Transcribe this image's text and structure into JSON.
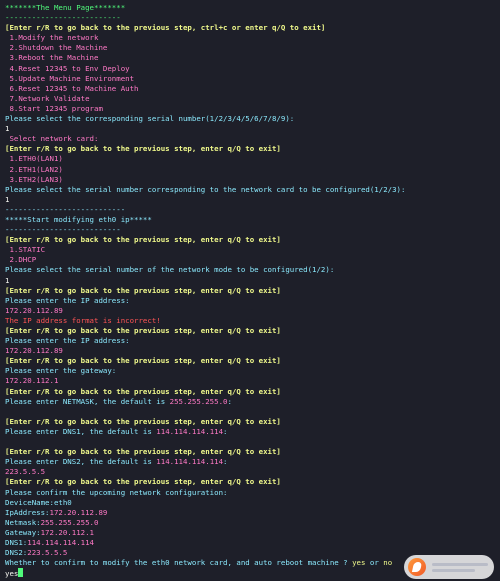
{
  "colors": {
    "green": "#50fa7b",
    "yellow": "#f1fa8c",
    "magenta": "#ff79c6",
    "cyan": "#8be9fd",
    "red": "#ff5555",
    "white": "#f8f8f2",
    "background": "#1e1f29"
  },
  "lines": [
    {
      "segments": [
        {
          "text": "*******The Menu Page*******",
          "color": "green"
        }
      ]
    },
    {
      "segments": [
        {
          "text": "--------------------------",
          "color": "green"
        }
      ]
    },
    {
      "segments": [
        {
          "text": "[Enter r/R to go back to the previous step, ctrl+c or enter q/Q to exit]",
          "color": "yellow",
          "bold": true
        }
      ]
    },
    {
      "segments": [
        {
          "text": " 1.Modify the network",
          "color": "magenta"
        }
      ]
    },
    {
      "segments": [
        {
          "text": " 2.Shutdown the Machine",
          "color": "magenta"
        }
      ]
    },
    {
      "segments": [
        {
          "text": " 3.Reboot the Machine",
          "color": "magenta"
        }
      ]
    },
    {
      "segments": [
        {
          "text": " 4.Reset 12345 to Env Deploy",
          "color": "magenta"
        }
      ]
    },
    {
      "segments": [
        {
          "text": " 5.Update Machine Environment",
          "color": "magenta"
        }
      ]
    },
    {
      "segments": [
        {
          "text": " 6.Reset 12345 to Machine Auth",
          "color": "magenta"
        }
      ]
    },
    {
      "segments": [
        {
          "text": " 7.Network Validate",
          "color": "magenta"
        }
      ]
    },
    {
      "segments": [
        {
          "text": " 8.Start 12345 program",
          "color": "magenta"
        }
      ]
    },
    {
      "segments": [
        {
          "text": "Please select the corresponding serial number(1/2/3/4/5/6/7/8/9):",
          "color": "cyan"
        }
      ]
    },
    {
      "segments": [
        {
          "text": "1",
          "color": "white"
        }
      ]
    },
    {
      "segments": [
        {
          "text": " Select network card:",
          "color": "magenta"
        }
      ]
    },
    {
      "segments": [
        {
          "text": "[Enter r/R to go back to the previous step, enter q/Q to exit]",
          "color": "yellow",
          "bold": true
        }
      ]
    },
    {
      "segments": [
        {
          "text": " 1.ETH0(LAN1)",
          "color": "magenta"
        }
      ]
    },
    {
      "segments": [
        {
          "text": " 2.ETH1(LAN2)",
          "color": "magenta"
        }
      ]
    },
    {
      "segments": [
        {
          "text": " 3.ETH2(LAN3)",
          "color": "magenta"
        }
      ]
    },
    {
      "segments": [
        {
          "text": "Please select the serial number corresponding to the network card to be configured(1/2/3):",
          "color": "cyan"
        }
      ]
    },
    {
      "segments": [
        {
          "text": "1",
          "color": "white"
        }
      ]
    },
    {
      "segments": [
        {
          "text": "---------------------------",
          "color": "cyan"
        }
      ]
    },
    {
      "segments": [
        {
          "text": "*****Start modifying eth0 ip*****",
          "color": "cyan"
        }
      ]
    },
    {
      "segments": [
        {
          "text": "--------------------------",
          "color": "cyan"
        }
      ]
    },
    {
      "segments": [
        {
          "text": "[Enter r/R to go back to the previous step, enter q/Q to exit]",
          "color": "yellow",
          "bold": true
        }
      ]
    },
    {
      "segments": [
        {
          "text": " 1.STATIC",
          "color": "magenta"
        }
      ]
    },
    {
      "segments": [
        {
          "text": " 2.DHCP",
          "color": "magenta"
        }
      ]
    },
    {
      "segments": [
        {
          "text": "Please select the serial number of the network mode to be configured(1/2):",
          "color": "cyan"
        }
      ]
    },
    {
      "segments": [
        {
          "text": "1",
          "color": "white"
        }
      ]
    },
    {
      "segments": [
        {
          "text": "[Enter r/R to go back to the previous step, enter q/Q to exit]",
          "color": "yellow",
          "bold": true
        }
      ]
    },
    {
      "segments": [
        {
          "text": "Please enter the IP address:",
          "color": "cyan"
        }
      ]
    },
    {
      "segments": [
        {
          "text": "172.20.112.89",
          "color": "magenta"
        }
      ]
    },
    {
      "segments": [
        {
          "text": "The IP address format is incorrect!",
          "color": "red"
        }
      ]
    },
    {
      "segments": [
        {
          "text": "[Enter r/R to go back to the previous step, enter q/Q to exit]",
          "color": "yellow",
          "bold": true
        }
      ]
    },
    {
      "segments": [
        {
          "text": "Please enter the IP address:",
          "color": "cyan"
        }
      ]
    },
    {
      "segments": [
        {
          "text": "172.20.112.89",
          "color": "magenta"
        }
      ]
    },
    {
      "segments": [
        {
          "text": "[Enter r/R to go back to the previous step, enter q/Q to exit]",
          "color": "yellow",
          "bold": true
        }
      ]
    },
    {
      "segments": [
        {
          "text": "Please enter the gateway:",
          "color": "cyan"
        }
      ]
    },
    {
      "segments": [
        {
          "text": "172.20.112.1",
          "color": "magenta"
        }
      ]
    },
    {
      "segments": [
        {
          "text": "[Enter r/R to go back to the previous step, enter q/Q to exit]",
          "color": "yellow",
          "bold": true
        }
      ]
    },
    {
      "segments": [
        {
          "text": "Please enter NETMASK, the default is ",
          "color": "cyan"
        },
        {
          "text": "255.255.255.0",
          "color": "magenta"
        },
        {
          "text": ":",
          "color": "cyan"
        }
      ]
    },
    {
      "segments": []
    },
    {
      "segments": [
        {
          "text": "[Enter r/R to go back to the previous step, enter q/Q to exit]",
          "color": "yellow",
          "bold": true
        }
      ]
    },
    {
      "segments": [
        {
          "text": "Please enter DNS1, the default is ",
          "color": "cyan"
        },
        {
          "text": "114.114.114.114",
          "color": "magenta"
        },
        {
          "text": ":",
          "color": "cyan"
        }
      ]
    },
    {
      "segments": []
    },
    {
      "segments": [
        {
          "text": "[Enter r/R to go back to the previous step, enter q/Q to exit]",
          "color": "yellow",
          "bold": true
        }
      ]
    },
    {
      "segments": [
        {
          "text": "Please enter DNS2, the default is ",
          "color": "cyan"
        },
        {
          "text": "114.114.114.114",
          "color": "magenta"
        },
        {
          "text": ":",
          "color": "cyan"
        }
      ]
    },
    {
      "segments": [
        {
          "text": "223.5.5.5",
          "color": "magenta"
        }
      ]
    },
    {
      "segments": [
        {
          "text": "[Enter r/R to go back to the previous step, enter q/Q to exit]",
          "color": "yellow",
          "bold": true
        }
      ]
    },
    {
      "segments": [
        {
          "text": "Please confirm the upcoming network configuration:",
          "color": "cyan"
        }
      ]
    },
    {
      "segments": [
        {
          "text": "DeviceName:eth0",
          "color": "cyan"
        }
      ]
    },
    {
      "segments": [
        {
          "text": "IpAddress:",
          "color": "cyan"
        },
        {
          "text": "172.20.112.89",
          "color": "magenta"
        }
      ]
    },
    {
      "segments": [
        {
          "text": "Netmask:",
          "color": "cyan"
        },
        {
          "text": "255.255.255.0",
          "color": "magenta"
        }
      ]
    },
    {
      "segments": [
        {
          "text": "Gateway:",
          "color": "cyan"
        },
        {
          "text": "172.20.112.1",
          "color": "magenta"
        }
      ]
    },
    {
      "segments": [
        {
          "text": "DNS1:",
          "color": "cyan"
        },
        {
          "text": "114.114.114.114",
          "color": "magenta"
        }
      ]
    },
    {
      "segments": [
        {
          "text": "DNS2:",
          "color": "cyan"
        },
        {
          "text": "223.5.5.5",
          "color": "magenta"
        }
      ]
    },
    {
      "segments": [
        {
          "text": "Whether to confirm to modify the eth0 network card, and auto reboot machine ? ",
          "color": "cyan"
        },
        {
          "text": "yes",
          "color": "yellow"
        },
        {
          "text": " or ",
          "color": "cyan"
        },
        {
          "text": "no",
          "color": "yellow"
        }
      ]
    }
  ],
  "input": {
    "text": "yes",
    "color": "white"
  }
}
